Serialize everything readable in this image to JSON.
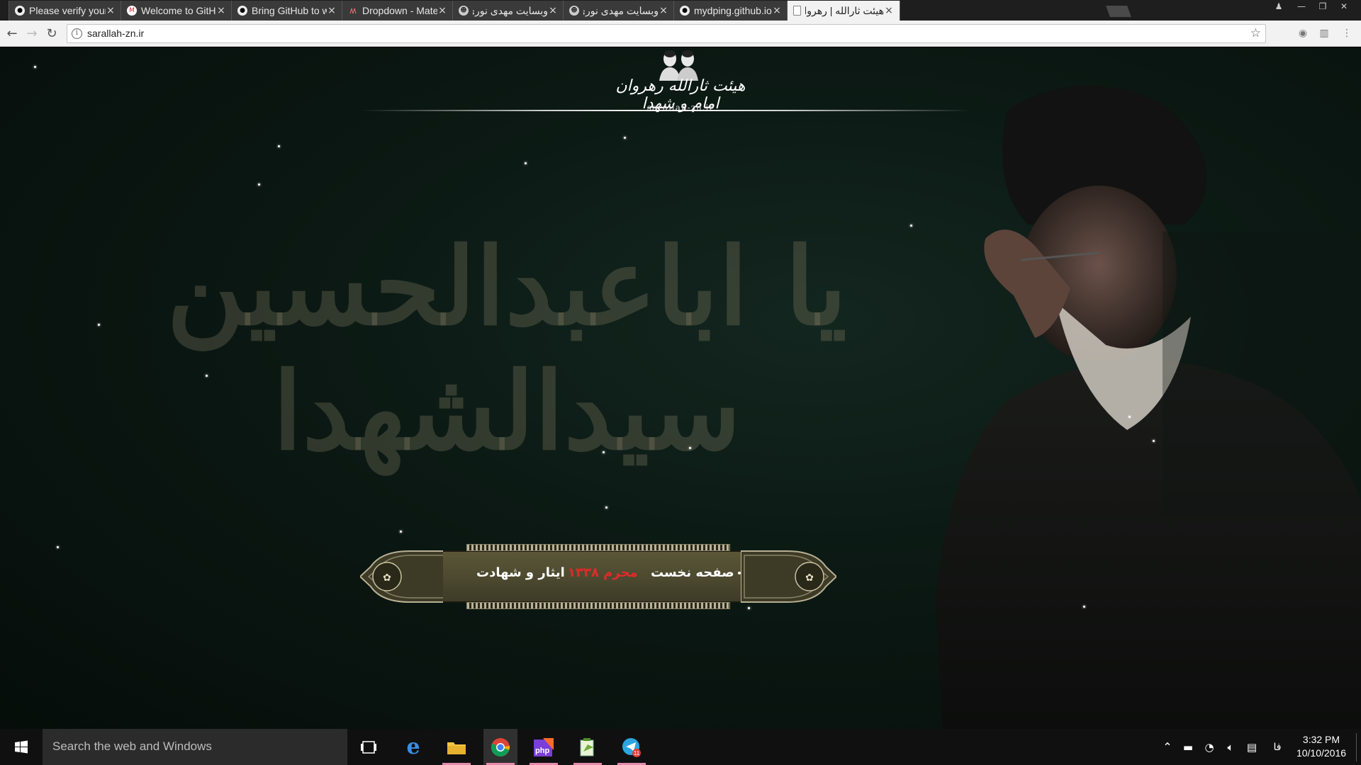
{
  "browser": {
    "tabs": [
      {
        "title": "Please verify your email",
        "icon": "github-icon",
        "active": false
      },
      {
        "title": "Welcome to GitHub",
        "icon": "gmail-icon",
        "active": false
      },
      {
        "title": "Bring GitHub to work",
        "icon": "github-icon",
        "active": false
      },
      {
        "title": "Dropdown - Materialize",
        "icon": "materialize-icon",
        "active": false
      },
      {
        "title": "وبسایت مهدی نوری",
        "icon": "avatar-icon",
        "active": false
      },
      {
        "title": "وبسایت مهدی نوری",
        "icon": "avatar-icon",
        "active": false
      },
      {
        "title": "mydping.github.io/",
        "icon": "github-icon",
        "active": false
      },
      {
        "title": "هیئت ثارالله | رهروان",
        "icon": "page-icon",
        "active": true
      }
    ],
    "tab_close_glyph": "×",
    "url": "sarallah-zn.ir"
  },
  "site": {
    "logo_name": "هیئت ثارالله رهروان امام و شهدا",
    "logo_domain": "sarallah-zn.ir",
    "calligraphy": "یا اباعبدالحسین سیدالشهدا",
    "nav": [
      {
        "label": "صفحه نخست",
        "highlight": false
      },
      {
        "label": "محرم ۱۳۳۸",
        "highlight": true
      },
      {
        "label": "ایثار و شهادت",
        "highlight": false
      }
    ],
    "accent_color": "#e02a2a"
  },
  "taskbar": {
    "search_placeholder": "Search the web and Windows",
    "phpstorm_label": "php",
    "telegram_badge": "11",
    "language": "فا",
    "time": "3:32 PM",
    "date": "10/10/2016"
  }
}
